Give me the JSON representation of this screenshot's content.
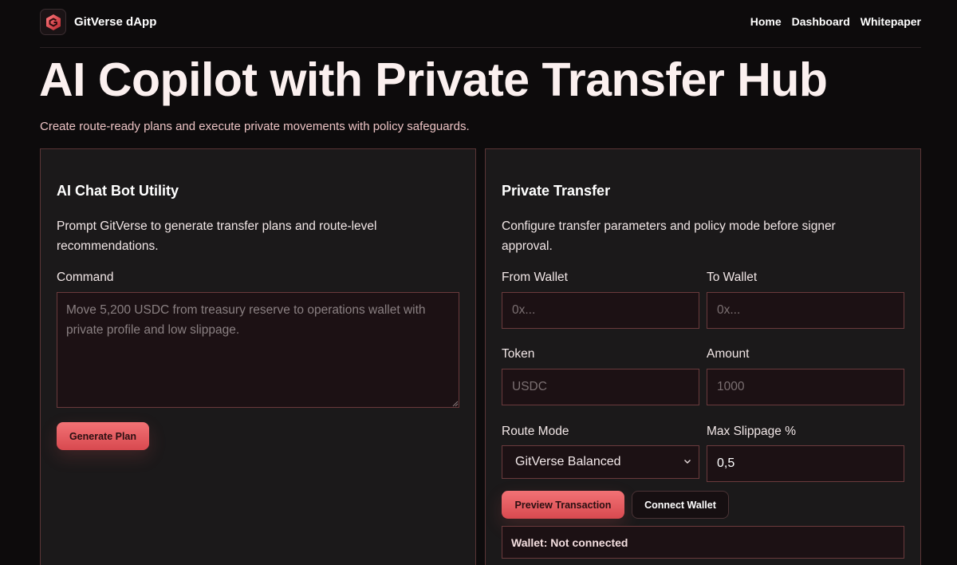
{
  "brand": {
    "name": "GitVerse dApp",
    "logo_icon": "gitverse-logo-icon"
  },
  "nav": {
    "items": [
      "Home",
      "Dashboard",
      "Whitepaper"
    ]
  },
  "hero": {
    "title": "AI Copilot with Private Transfer Hub",
    "subtitle": "Create route-ready plans and execute private movements with policy safeguards."
  },
  "chat_card": {
    "title": "AI Chat Bot Utility",
    "description": "Prompt GitVerse to generate transfer plans and route-level recommendations.",
    "command_label": "Command",
    "command_value": "",
    "command_placeholder": "Move 5,200 USDC from treasury reserve to operations wallet with private profile and low slippage.",
    "generate_label": "Generate Plan"
  },
  "transfer_card": {
    "title": "Private Transfer",
    "description": "Configure transfer parameters and policy mode before signer approval.",
    "from_label": "From Wallet",
    "from_value": "",
    "from_placeholder": "0x...",
    "to_label": "To Wallet",
    "to_value": "",
    "to_placeholder": "0x...",
    "token_label": "Token",
    "token_value": "",
    "token_placeholder": "USDC",
    "amount_label": "Amount",
    "amount_value": "",
    "amount_placeholder": "1000",
    "route_label": "Route Mode",
    "route_value": "GitVerse Balanced",
    "slippage_label": "Max Slippage %",
    "slippage_value": "0,5",
    "preview_label": "Preview Transaction",
    "connect_label": "Connect Wallet",
    "wallet_status": "Wallet: Not connected"
  },
  "colors": {
    "accent": "#e85b60",
    "background": "#0d0b0c",
    "card_border": "#5a3536",
    "subtitle": "#ecc3c4"
  }
}
